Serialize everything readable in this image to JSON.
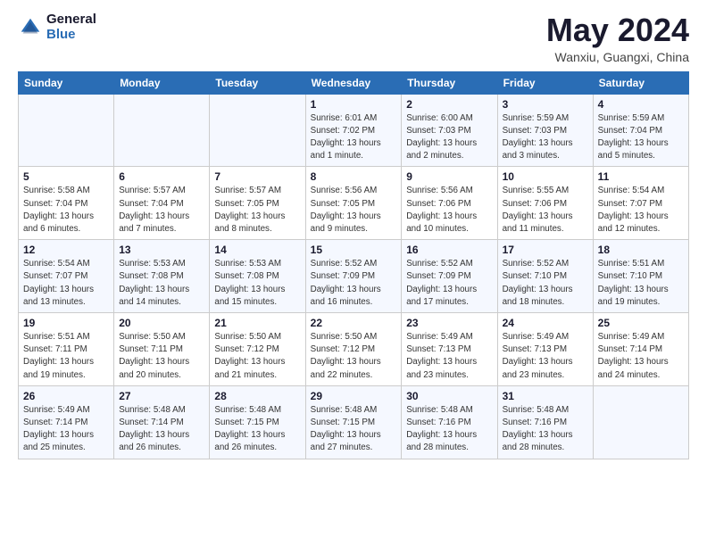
{
  "header": {
    "logo_general": "General",
    "logo_blue": "Blue",
    "month_title": "May 2024",
    "location": "Wanxiu, Guangxi, China"
  },
  "days_of_week": [
    "Sunday",
    "Monday",
    "Tuesday",
    "Wednesday",
    "Thursday",
    "Friday",
    "Saturday"
  ],
  "weeks": [
    [
      {
        "day": "",
        "info": ""
      },
      {
        "day": "",
        "info": ""
      },
      {
        "day": "",
        "info": ""
      },
      {
        "day": "1",
        "info": "Sunrise: 6:01 AM\nSunset: 7:02 PM\nDaylight: 13 hours\nand 1 minute."
      },
      {
        "day": "2",
        "info": "Sunrise: 6:00 AM\nSunset: 7:03 PM\nDaylight: 13 hours\nand 2 minutes."
      },
      {
        "day": "3",
        "info": "Sunrise: 5:59 AM\nSunset: 7:03 PM\nDaylight: 13 hours\nand 3 minutes."
      },
      {
        "day": "4",
        "info": "Sunrise: 5:59 AM\nSunset: 7:04 PM\nDaylight: 13 hours\nand 5 minutes."
      }
    ],
    [
      {
        "day": "5",
        "info": "Sunrise: 5:58 AM\nSunset: 7:04 PM\nDaylight: 13 hours\nand 6 minutes."
      },
      {
        "day": "6",
        "info": "Sunrise: 5:57 AM\nSunset: 7:04 PM\nDaylight: 13 hours\nand 7 minutes."
      },
      {
        "day": "7",
        "info": "Sunrise: 5:57 AM\nSunset: 7:05 PM\nDaylight: 13 hours\nand 8 minutes."
      },
      {
        "day": "8",
        "info": "Sunrise: 5:56 AM\nSunset: 7:05 PM\nDaylight: 13 hours\nand 9 minutes."
      },
      {
        "day": "9",
        "info": "Sunrise: 5:56 AM\nSunset: 7:06 PM\nDaylight: 13 hours\nand 10 minutes."
      },
      {
        "day": "10",
        "info": "Sunrise: 5:55 AM\nSunset: 7:06 PM\nDaylight: 13 hours\nand 11 minutes."
      },
      {
        "day": "11",
        "info": "Sunrise: 5:54 AM\nSunset: 7:07 PM\nDaylight: 13 hours\nand 12 minutes."
      }
    ],
    [
      {
        "day": "12",
        "info": "Sunrise: 5:54 AM\nSunset: 7:07 PM\nDaylight: 13 hours\nand 13 minutes."
      },
      {
        "day": "13",
        "info": "Sunrise: 5:53 AM\nSunset: 7:08 PM\nDaylight: 13 hours\nand 14 minutes."
      },
      {
        "day": "14",
        "info": "Sunrise: 5:53 AM\nSunset: 7:08 PM\nDaylight: 13 hours\nand 15 minutes."
      },
      {
        "day": "15",
        "info": "Sunrise: 5:52 AM\nSunset: 7:09 PM\nDaylight: 13 hours\nand 16 minutes."
      },
      {
        "day": "16",
        "info": "Sunrise: 5:52 AM\nSunset: 7:09 PM\nDaylight: 13 hours\nand 17 minutes."
      },
      {
        "day": "17",
        "info": "Sunrise: 5:52 AM\nSunset: 7:10 PM\nDaylight: 13 hours\nand 18 minutes."
      },
      {
        "day": "18",
        "info": "Sunrise: 5:51 AM\nSunset: 7:10 PM\nDaylight: 13 hours\nand 19 minutes."
      }
    ],
    [
      {
        "day": "19",
        "info": "Sunrise: 5:51 AM\nSunset: 7:11 PM\nDaylight: 13 hours\nand 19 minutes."
      },
      {
        "day": "20",
        "info": "Sunrise: 5:50 AM\nSunset: 7:11 PM\nDaylight: 13 hours\nand 20 minutes."
      },
      {
        "day": "21",
        "info": "Sunrise: 5:50 AM\nSunset: 7:12 PM\nDaylight: 13 hours\nand 21 minutes."
      },
      {
        "day": "22",
        "info": "Sunrise: 5:50 AM\nSunset: 7:12 PM\nDaylight: 13 hours\nand 22 minutes."
      },
      {
        "day": "23",
        "info": "Sunrise: 5:49 AM\nSunset: 7:13 PM\nDaylight: 13 hours\nand 23 minutes."
      },
      {
        "day": "24",
        "info": "Sunrise: 5:49 AM\nSunset: 7:13 PM\nDaylight: 13 hours\nand 23 minutes."
      },
      {
        "day": "25",
        "info": "Sunrise: 5:49 AM\nSunset: 7:14 PM\nDaylight: 13 hours\nand 24 minutes."
      }
    ],
    [
      {
        "day": "26",
        "info": "Sunrise: 5:49 AM\nSunset: 7:14 PM\nDaylight: 13 hours\nand 25 minutes."
      },
      {
        "day": "27",
        "info": "Sunrise: 5:48 AM\nSunset: 7:14 PM\nDaylight: 13 hours\nand 26 minutes."
      },
      {
        "day": "28",
        "info": "Sunrise: 5:48 AM\nSunset: 7:15 PM\nDaylight: 13 hours\nand 26 minutes."
      },
      {
        "day": "29",
        "info": "Sunrise: 5:48 AM\nSunset: 7:15 PM\nDaylight: 13 hours\nand 27 minutes."
      },
      {
        "day": "30",
        "info": "Sunrise: 5:48 AM\nSunset: 7:16 PM\nDaylight: 13 hours\nand 28 minutes."
      },
      {
        "day": "31",
        "info": "Sunrise: 5:48 AM\nSunset: 7:16 PM\nDaylight: 13 hours\nand 28 minutes."
      },
      {
        "day": "",
        "info": ""
      }
    ]
  ]
}
